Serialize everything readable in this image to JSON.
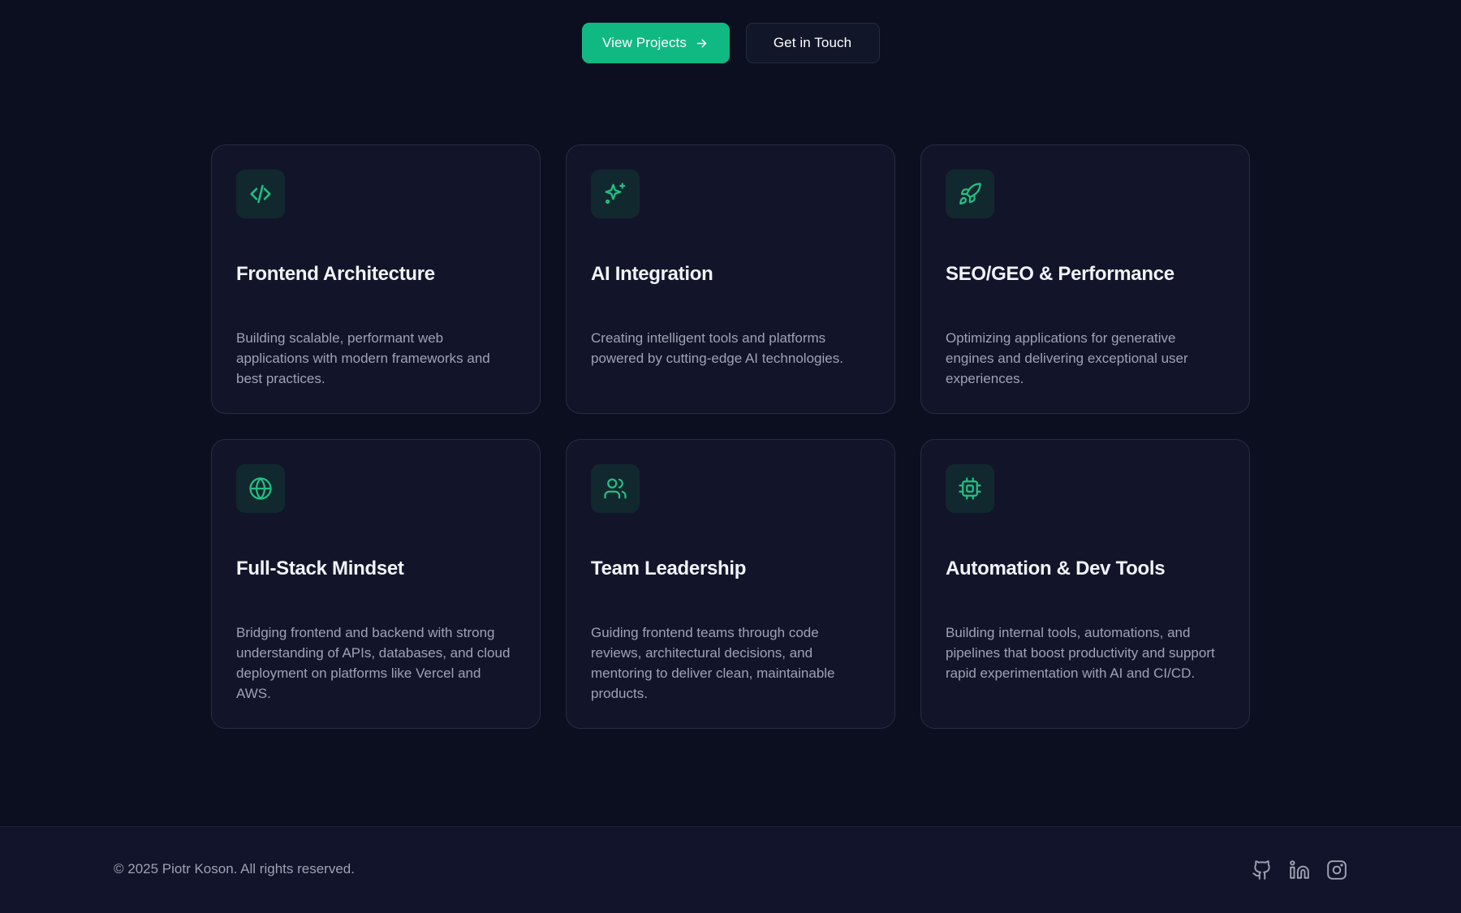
{
  "hero": {
    "primary_button": "View Projects",
    "secondary_button": "Get in Touch"
  },
  "features": [
    {
      "icon": "code-icon",
      "title": "Frontend Architecture",
      "description": "Building scalable, performant web applications with modern frameworks and best practices."
    },
    {
      "icon": "sparkles-icon",
      "title": "AI Integration",
      "description": "Creating intelligent tools and platforms powered by cutting-edge AI technologies."
    },
    {
      "icon": "rocket-icon",
      "title": "SEO/GEO & Performance",
      "description": "Optimizing applications for generative engines and delivering exceptional user experiences."
    },
    {
      "icon": "globe-icon",
      "title": "Full-Stack Mindset",
      "description": "Bridging frontend and backend with strong understanding of APIs, databases, and cloud deployment on platforms like Vercel and AWS."
    },
    {
      "icon": "users-icon",
      "title": "Team Leadership",
      "description": "Guiding frontend teams through code reviews, architectural decisions, and mentoring to deliver clean, maintainable products."
    },
    {
      "icon": "cpu-icon",
      "title": "Automation & Dev Tools",
      "description": "Building internal tools, automations, and pipelines that boost productivity and support rapid experimentation with AI and CI/CD."
    }
  ],
  "footer": {
    "copyright": "© 2025 Piotr Koson. All rights reserved.",
    "social": [
      "github-icon",
      "linkedin-icon",
      "instagram-icon"
    ]
  },
  "colors": {
    "background": "#0c0f20",
    "card": "#12152a",
    "accent": "#10b981",
    "icon_accent": "#22c084"
  }
}
